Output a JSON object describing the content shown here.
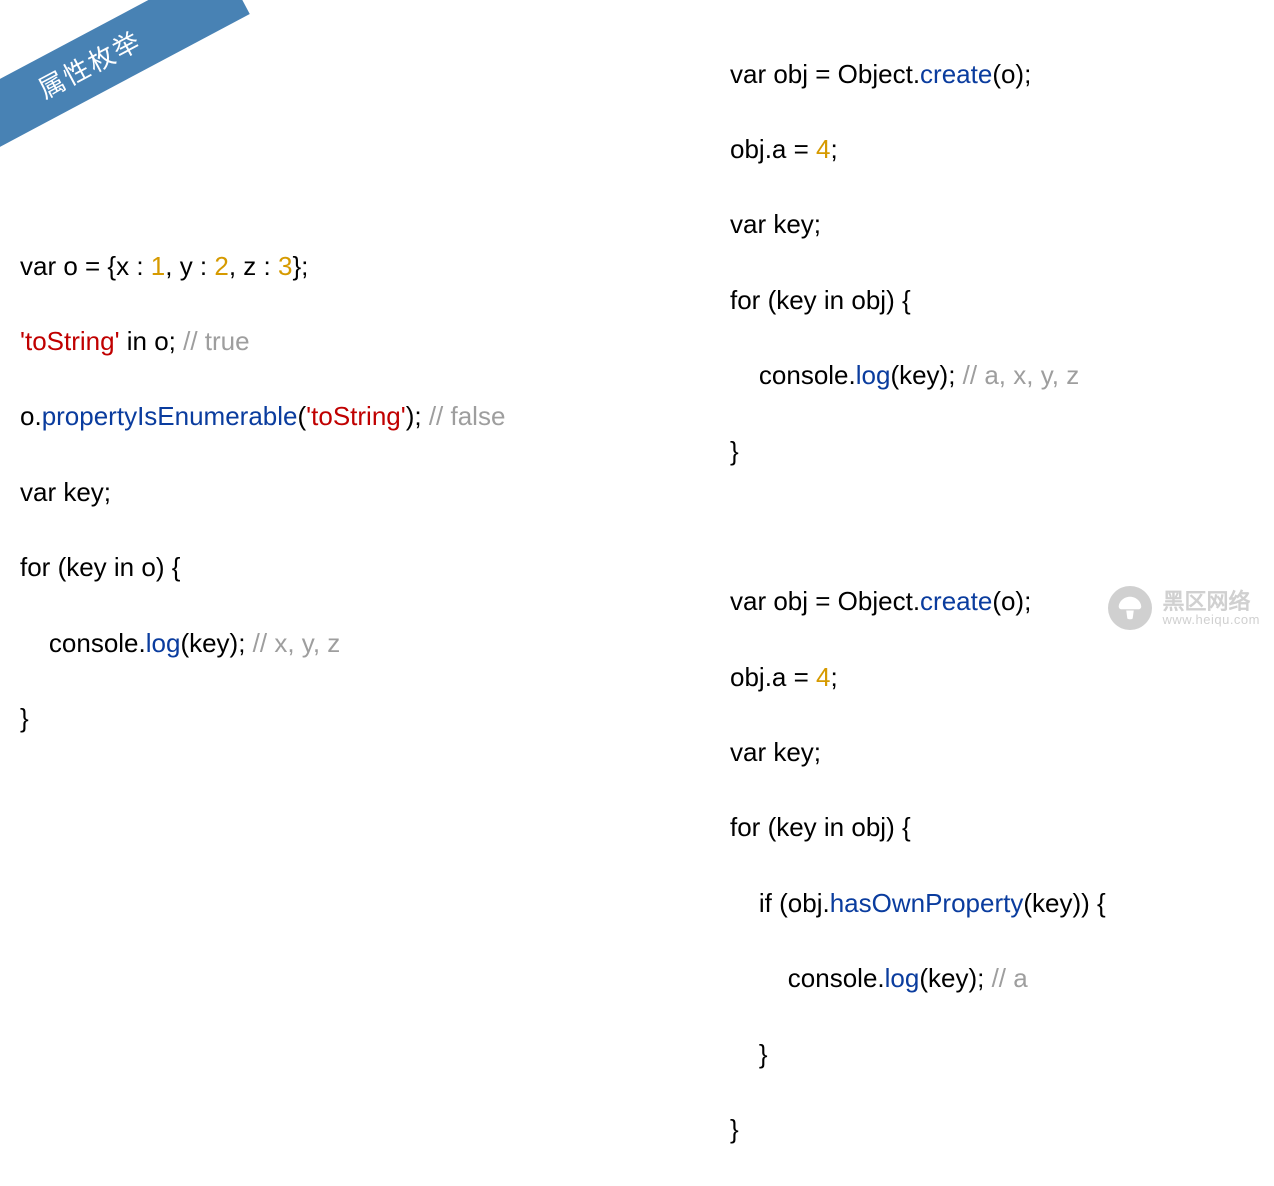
{
  "ribbon": {
    "title": "属性枚举"
  },
  "watermark": {
    "main": "黑区网络",
    "sub": "www.heiqu.com"
  },
  "left": {
    "l1": {
      "a": "var o = {x : ",
      "n1": "1",
      "b": ", y : ",
      "n2": "2",
      "c": ", z : ",
      "n3": "3",
      "d": "};"
    },
    "l2": {
      "a": "'toString'",
      "b": " in o; ",
      "c": "// true"
    },
    "l3": {
      "a": "o.",
      "b": "propertyIsEnumerable",
      "c": "(",
      "d": "'toString'",
      "e": "); ",
      "f": "// false"
    },
    "l4": "var key;",
    "l5": "for (key in o) {",
    "l6": {
      "a": "    console.",
      "b": "log",
      "c": "(key); ",
      "d": "// x, y, z"
    },
    "l7": "}"
  },
  "right": {
    "b1l1": {
      "a": "var obj = Object.",
      "b": "create",
      "c": "(o);"
    },
    "b1l2": {
      "a": "obj.a = ",
      "b": "4",
      "c": ";"
    },
    "b1l3": "var key;",
    "b1l4": "for (key in obj) {",
    "b1l5": {
      "a": "    console.",
      "b": "log",
      "c": "(key); ",
      "d": "// a, x, y, z"
    },
    "b1l6": "}",
    "gap": "",
    "b2l1": {
      "a": "var obj = Object.",
      "b": "create",
      "c": "(o);"
    },
    "b2l2": {
      "a": "obj.a = ",
      "b": "4",
      "c": ";"
    },
    "b2l3": "var key;",
    "b2l4": "for (key in obj) {",
    "b2l5": {
      "a": "    if (obj.",
      "b": "hasOwnProperty",
      "c": "(key)) {"
    },
    "b2l6": {
      "a": "        console.",
      "b": "log",
      "c": "(key); ",
      "d": "// a"
    },
    "b2l7": "    }",
    "b2l8": "}"
  }
}
